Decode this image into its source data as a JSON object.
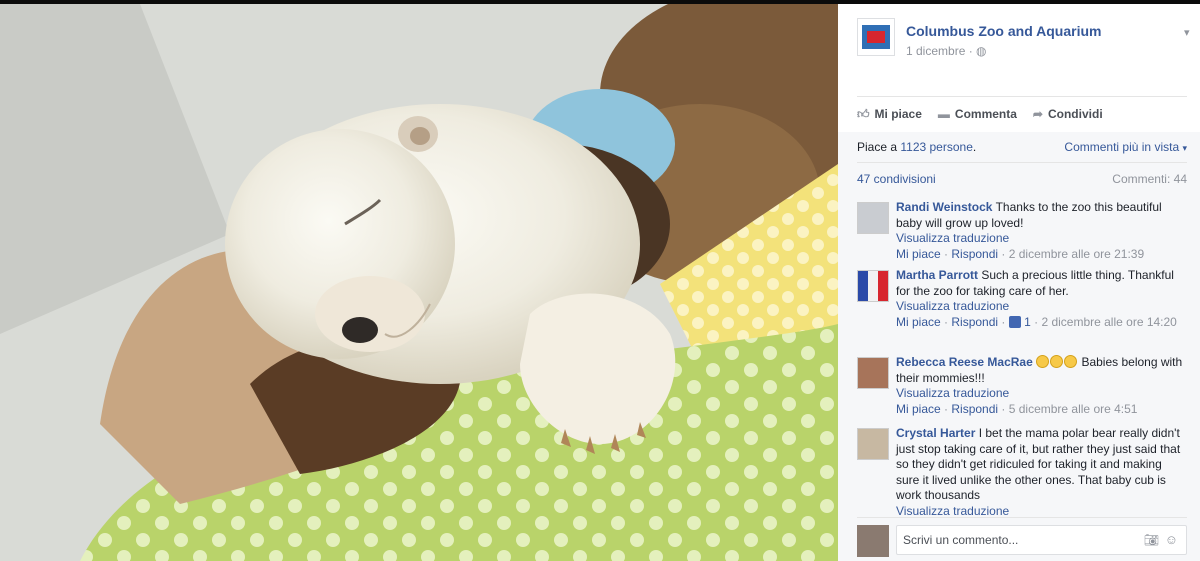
{
  "post": {
    "page_name": "Columbus Zoo and Aquarium",
    "date": "1 dicembre",
    "separator": " · ",
    "globe_icon": "globe-icon",
    "logo_text": "ZOO"
  },
  "actions": {
    "like_label": "Mi piace",
    "comment_label": "Commenta",
    "share_label": "Condividi"
  },
  "summary": {
    "likes_prefix": "Piace a ",
    "likes_link": "1123 persone",
    "likes_suffix": ".",
    "top_comments": "Commenti più in vista",
    "shares": "47 condivisioni",
    "comments_count": "Commenti: 44"
  },
  "comments": [
    {
      "name": "Randi Weinstock",
      "text": "Thanks to the zoo this beautiful baby will grow up loved!",
      "translate": "Visualizza traduzione",
      "like": "Mi piace",
      "reply": "Rispondi",
      "sep": " · ",
      "time": "2 dicembre alle ore 21:39"
    },
    {
      "name": "Martha Parrott",
      "text": "Such a precious little thing. Thankful for the zoo for taking care of her.",
      "translate": "Visualizza traduzione",
      "like": "Mi piace",
      "reply": "Rispondi",
      "sep": " · ",
      "likes": "1",
      "time": "2 dicembre alle ore 14:20"
    },
    {
      "name": "Rebecca Reese MacRae",
      "text": "Babies belong with their mommies!!!",
      "translate": "Visualizza traduzione",
      "like": "Mi piace",
      "reply": "Rispondi",
      "sep": " · ",
      "time": "5 dicembre alle ore 4:51"
    },
    {
      "name": "Crystal Harter",
      "text": "I bet the mama polar bear really didn't just stop taking care of it, but rather they just said that so they didn't get ridiculed for taking it and making sure it lived unlike the other ones. That baby cub is work thousands",
      "translate": "Visualizza traduzione"
    }
  ],
  "composer": {
    "placeholder": "Scrivi un commento..."
  },
  "colors": {
    "link": "#365899",
    "muted": "#90949c",
    "panel_bg": "#f6f7f9"
  }
}
